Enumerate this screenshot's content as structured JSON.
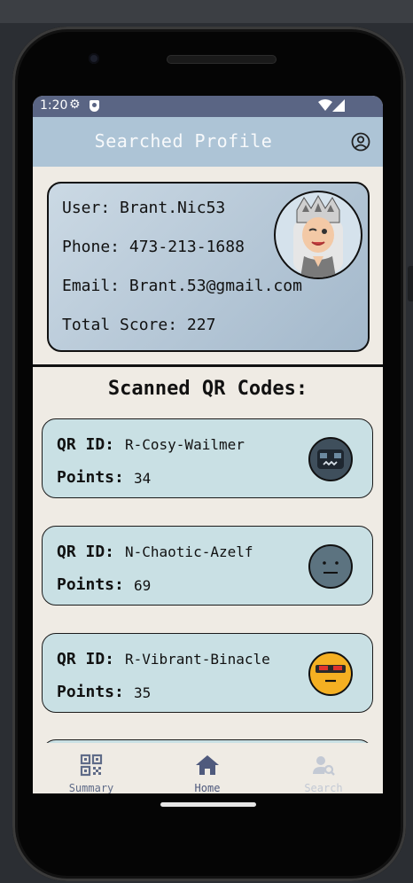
{
  "status_bar": {
    "time": "1:20"
  },
  "app_bar": {
    "title": "Searched Profile"
  },
  "profile": {
    "user_label": "User:",
    "user": "Brant.Nic53",
    "phone_label": "Phone:",
    "phone": "473-213-1688",
    "email_label": "Email:",
    "email": "Brant.53@gmail.com",
    "score_label": "Total Score:",
    "score": "227"
  },
  "list": {
    "title": "Scanned QR Codes:",
    "id_label": "QR ID:",
    "points_label": "Points:",
    "items": [
      {
        "id": "R-Cosy-Wailmer",
        "points": "34",
        "face_icon": "robot-face-icon"
      },
      {
        "id": "N-Chaotic-Azelf",
        "points": "69",
        "face_icon": "neutral-face-icon"
      },
      {
        "id": "R-Vibrant-Binacle",
        "points": "35",
        "face_icon": "sunglasses-face-icon"
      }
    ]
  },
  "nav": {
    "items": [
      {
        "label": "Summary",
        "icon": "qr-code-icon"
      },
      {
        "label": "Home",
        "icon": "home-icon"
      },
      {
        "label": "Search",
        "icon": "user-search-icon"
      }
    ]
  },
  "colors": {
    "status_bar": "#5a6584",
    "app_bar": "#adc4d6",
    "background": "#efebe4",
    "qr_card": "#c9e0e4",
    "nav_active": "#4f5a7d",
    "nav_inactive": "#c3c9d4"
  }
}
